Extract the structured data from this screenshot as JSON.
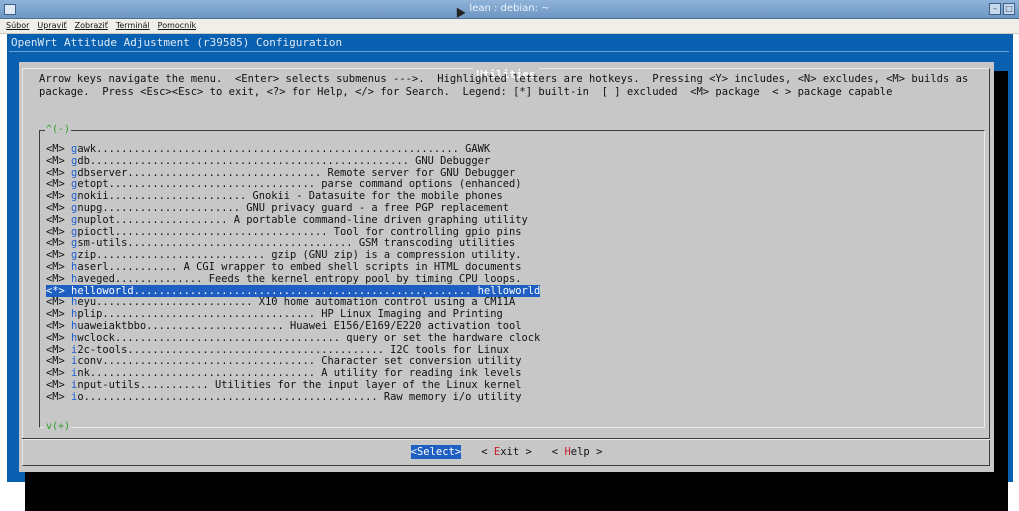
{
  "window": {
    "title": "lean : debian: ~",
    "min_label": "–",
    "max_label": "□"
  },
  "menubar": {
    "items": [
      "Súbor",
      "Upraviť",
      "Zobraziť",
      "Terminál",
      "Pomocník"
    ]
  },
  "config_title": "OpenWrt Attitude Adjustment (r39585) Configuration",
  "dialog": {
    "title": "Utilities",
    "help_lines": [
      "Arrow keys navigate the menu.  <Enter> selects submenus --->.  Highlighted letters are hotkeys.  Pressing <Y> includes, <N> excludes, <M> builds as",
      "package.  Press <Esc><Esc> to exit, <?> for Help, </> for Search.  Legend: [*] built-in  [ ] excluded  <M> package  < > package capable"
    ],
    "more_up": "^(-)",
    "more_down": "v(+)",
    "items": [
      {
        "state": "<M>",
        "hot": "g",
        "rest": "awk.......................................................... GAWK"
      },
      {
        "state": "<M>",
        "hot": "g",
        "rest": "db................................................... GNU Debugger"
      },
      {
        "state": "<M>",
        "hot": "g",
        "rest": "dbserver............................... Remote server for GNU Debugger"
      },
      {
        "state": "<M>",
        "hot": "g",
        "rest": "etopt................................. parse command options (enhanced)"
      },
      {
        "state": "<M>",
        "hot": "g",
        "rest": "nokii...................... Gnokii - Datasuite for the mobile phones"
      },
      {
        "state": "<M>",
        "hot": "g",
        "rest": "nupg...................... GNU privacy guard - a free PGP replacement"
      },
      {
        "state": "<M>",
        "hot": "g",
        "rest": "nuplot.................. A portable command-line driven graphing utility"
      },
      {
        "state": "<M>",
        "hot": "g",
        "rest": "pioctl.................................. Tool for controlling gpio pins"
      },
      {
        "state": "<M>",
        "hot": "g",
        "rest": "sm-utils.................................... GSM transcoding utilities"
      },
      {
        "state": "<M>",
        "hot": "g",
        "rest": "zip........................... gzip (GNU zip) is a compression utility."
      },
      {
        "state": "<M>",
        "hot": "h",
        "rest": "aserl........... A CGI wrapper to embed shell scripts in HTML documents"
      },
      {
        "state": "<M>",
        "hot": "h",
        "rest": "aveged.............. Feeds the kernel entropy pool by timing CPU loops."
      },
      {
        "state": "<*>",
        "hot": "h",
        "rest": "elloworld...................................................... helloworld",
        "selected": true
      },
      {
        "state": "<M>",
        "hot": "h",
        "rest": "eyu......................... X10 home automation control using a CM11A"
      },
      {
        "state": "<M>",
        "hot": "h",
        "rest": "plip.................................. HP Linux Imaging and Printing"
      },
      {
        "state": "<M>",
        "hot": "h",
        "rest": "uaweiaktbbo...................... Huawei E156/E169/E220 activation tool"
      },
      {
        "state": "<M>",
        "hot": "h",
        "rest": "wclock.................................... query or set the hardware clock"
      },
      {
        "state": "<M>",
        "hot": "i",
        "rest": "2c-tools......................................... I2C tools for Linux"
      },
      {
        "state": "<M>",
        "hot": "i",
        "rest": "conv.................................. Character set conversion utility"
      },
      {
        "state": "<M>",
        "hot": "i",
        "rest": "nk.................................... A utility for reading ink levels"
      },
      {
        "state": "<M>",
        "hot": "i",
        "rest": "nput-utils........... Utilities for the input layer of the Linux kernel"
      },
      {
        "state": "<M>",
        "hot": "i",
        "rest": "o............................................... Raw memory i/o utility"
      }
    ],
    "buttons": [
      {
        "pre": "<",
        "hot": "S",
        "rest": "elect>",
        "active": true,
        "name": "select-button"
      },
      {
        "pre": "< ",
        "hot": "E",
        "rest": "xit >",
        "active": false,
        "name": "exit-button"
      },
      {
        "pre": "< ",
        "hot": "H",
        "rest": "elp >",
        "active": false,
        "name": "help-button"
      }
    ]
  },
  "colors": {
    "terminal_bg": "#0a60b0",
    "dialog_bg": "#c7c7c7",
    "selection": "#1f5fc4",
    "hotkey": "#1d5fd0",
    "button_hotkey": "#c0202a",
    "scroll_marker": "#2ea12e"
  }
}
